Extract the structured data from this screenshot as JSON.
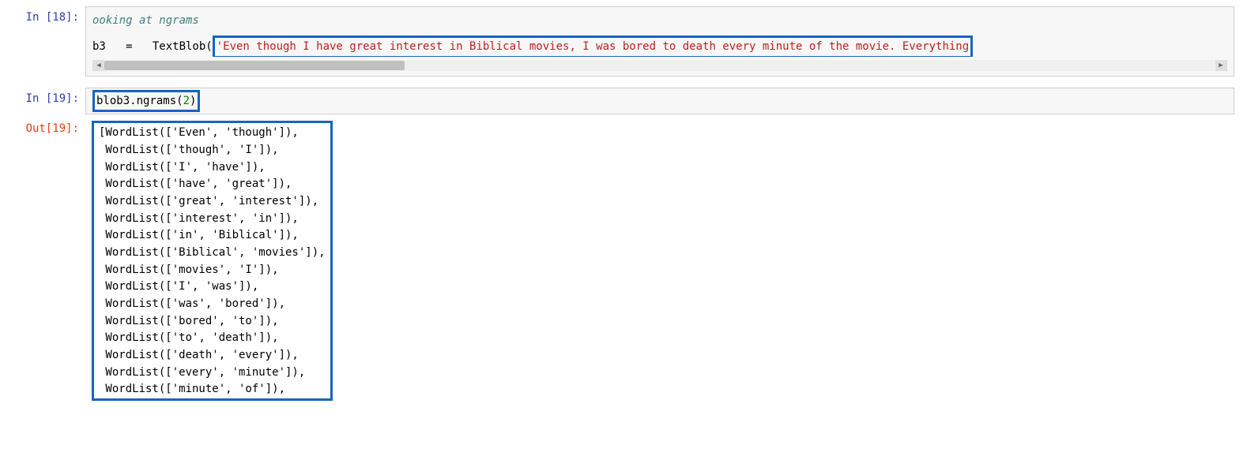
{
  "cells": {
    "c18": {
      "prompt": "In [18]:",
      "line1_comment_frag": "ooking at ngrams",
      "line2_pre": "b3   =   TextBlob(",
      "line2_str": "'Even though I have great interest in Biblical movies, I was bored to death every minute of the movie. Everything"
    },
    "c19in": {
      "prompt": "In [19]:",
      "code_pre": "blob3.ngrams(",
      "code_arg": "2",
      "code_post": ")"
    },
    "c19out": {
      "prompt": "Out[19]:",
      "lines": [
        "[WordList(['Even', 'though']),",
        " WordList(['though', 'I']),",
        " WordList(['I', 'have']),",
        " WordList(['have', 'great']),",
        " WordList(['great', 'interest']),",
        " WordList(['interest', 'in']),",
        " WordList(['in', 'Biblical']),",
        " WordList(['Biblical', 'movies']),",
        " WordList(['movies', 'I']),",
        " WordList(['I', 'was']),",
        " WordList(['was', 'bored']),",
        " WordList(['bored', 'to']),",
        " WordList(['to', 'death']),",
        " WordList(['death', 'every']),",
        " WordList(['every', 'minute']),",
        " WordList(['minute', 'of']),"
      ]
    }
  },
  "scroll": {
    "left_arrow": "◀",
    "right_arrow": "▶"
  }
}
